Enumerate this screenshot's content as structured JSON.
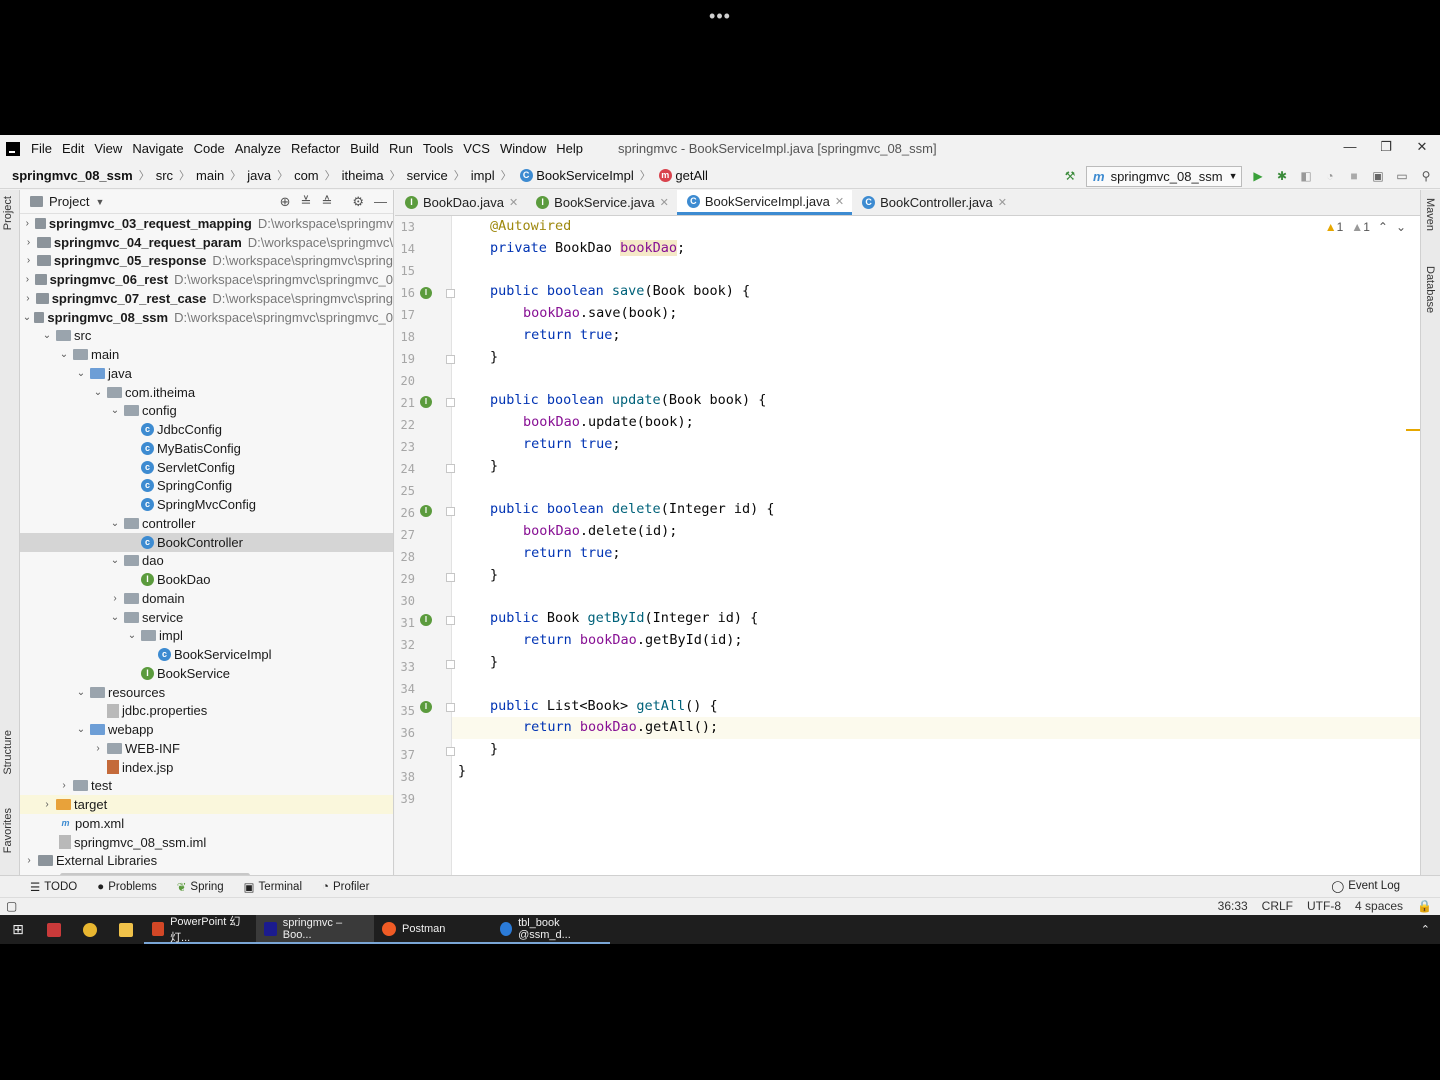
{
  "overlay": {
    "dots": "•••"
  },
  "menu": [
    "File",
    "Edit",
    "View",
    "Navigate",
    "Code",
    "Analyze",
    "Refactor",
    "Build",
    "Run",
    "Tools",
    "VCS",
    "Window",
    "Help"
  ],
  "window_title": "springmvc - BookServiceImpl.java [springmvc_08_ssm]",
  "window_controls": [
    "—",
    "❐",
    "✕"
  ],
  "breadcrumb": [
    "springmvc_08_ssm",
    "src",
    "main",
    "java",
    "com",
    "itheima",
    "service",
    "impl",
    "BookServiceImpl",
    "getAll"
  ],
  "run_config": "springmvc_08_ssm",
  "project_panel": {
    "title": "Project"
  },
  "left_stripe": {
    "project": "Project",
    "structure": "Structure",
    "favorites": "Favorites"
  },
  "right_stripe": {
    "maven": "Maven",
    "database": "Database"
  },
  "tree": [
    {
      "label": "springmvc_03_request_mapping",
      "path": "D:\\workspace\\springmv"
    },
    {
      "label": "springmvc_04_request_param",
      "path": "D:\\workspace\\springmvc\\"
    },
    {
      "label": "springmvc_05_response",
      "path": "D:\\workspace\\springmvc\\spring"
    },
    {
      "label": "springmvc_06_rest",
      "path": "D:\\workspace\\springmvc\\springmvc_0"
    },
    {
      "label": "springmvc_07_rest_case",
      "path": "D:\\workspace\\springmvc\\spring"
    },
    {
      "label": "springmvc_08_ssm",
      "path": "D:\\workspace\\springmvc\\springmvc_0"
    },
    {
      "label": "src"
    },
    {
      "label": "main"
    },
    {
      "label": "java"
    },
    {
      "label": "com.itheima"
    },
    {
      "label": "config"
    },
    {
      "label": "JdbcConfig"
    },
    {
      "label": "MyBatisConfig"
    },
    {
      "label": "ServletConfig"
    },
    {
      "label": "SpringConfig"
    },
    {
      "label": "SpringMvcConfig"
    },
    {
      "label": "controller"
    },
    {
      "label": "BookController"
    },
    {
      "label": "dao"
    },
    {
      "label": "BookDao"
    },
    {
      "label": "domain"
    },
    {
      "label": "service"
    },
    {
      "label": "impl"
    },
    {
      "label": "BookServiceImpl"
    },
    {
      "label": "BookService"
    },
    {
      "label": "resources"
    },
    {
      "label": "jdbc.properties"
    },
    {
      "label": "webapp"
    },
    {
      "label": "WEB-INF"
    },
    {
      "label": "index.jsp"
    },
    {
      "label": "test"
    },
    {
      "label": "target"
    },
    {
      "label": "pom.xml"
    },
    {
      "label": "springmvc_08_ssm.iml"
    },
    {
      "label": "External Libraries"
    }
  ],
  "tabs": [
    {
      "label": "BookDao.java",
      "icon": "I"
    },
    {
      "label": "BookService.java",
      "icon": "I"
    },
    {
      "label": "BookServiceImpl.java",
      "icon": "C"
    },
    {
      "label": "BookController.java",
      "icon": "C"
    }
  ],
  "warnings": {
    "warn_count": "1",
    "weak_count": "1"
  },
  "line_numbers": [
    "13",
    "14",
    "15",
    "16",
    "17",
    "18",
    "19",
    "20",
    "21",
    "22",
    "23",
    "24",
    "25",
    "26",
    "27",
    "28",
    "29",
    "30",
    "31",
    "32",
    "33",
    "34",
    "35",
    "36",
    "37",
    "38",
    "39"
  ],
  "code": {
    "l13": "@Autowired",
    "l14a": "private ",
    "l14b": "BookDao ",
    "l14c": "bookDao",
    "l14d": ";",
    "l16a": "public boolean ",
    "l16b": "save",
    "l16c": "(Book book) {",
    "l17a": "bookDao",
    ".l17b": "",
    "l17c": ".save(book);",
    "l18a": "return true",
    "l18b": ";",
    "l19": "}",
    "l21a": "public boolean ",
    "l21b": "update",
    "l21c": "(Book book) {",
    "l22a": "bookDao",
    "l22b": ".update(book);",
    "l23a": "return true",
    "l23b": ";",
    "l24": "}",
    "l26a": "public boolean ",
    "l26b": "delete",
    "l26c": "(Integer id) {",
    "l27a": "bookDao",
    "l27b": ".delete(id);",
    "l28a": "return true",
    "l28b": ";",
    "l29": "}",
    "l31a": "public ",
    "l31b": "Book ",
    "l31c": "getById",
    "l31d": "(Integer id) {",
    "l32a": "return ",
    "l32b": "bookDao",
    "l32c": ".getById(id);",
    "l33": "}",
    "l35a": "public ",
    "l35b": "List<Book> ",
    "l35c": "getAll",
    "l35d": "() {",
    "l36a": "return ",
    "l36b": "bookDao",
    "l36c": ".getAll();",
    "l37": "}",
    "l38": "}"
  },
  "bottom_tools": [
    "TODO",
    "Problems",
    "Spring",
    "Terminal",
    "Profiler"
  ],
  "event_log": "Event Log",
  "status": {
    "position": "36:33",
    "line_sep": "CRLF",
    "encoding": "UTF-8",
    "indent": "4 spaces"
  },
  "taskbar": [
    {
      "label": "PowerPoint 幻灯...",
      "color": "#d24726"
    },
    {
      "label": "springmvc – Boo...",
      "color": "#1b1b8f"
    },
    {
      "label": "Postman",
      "color": "#ef5b25"
    },
    {
      "label": "tbl_book @ssm_d...",
      "color": "#2b7bd8"
    }
  ]
}
